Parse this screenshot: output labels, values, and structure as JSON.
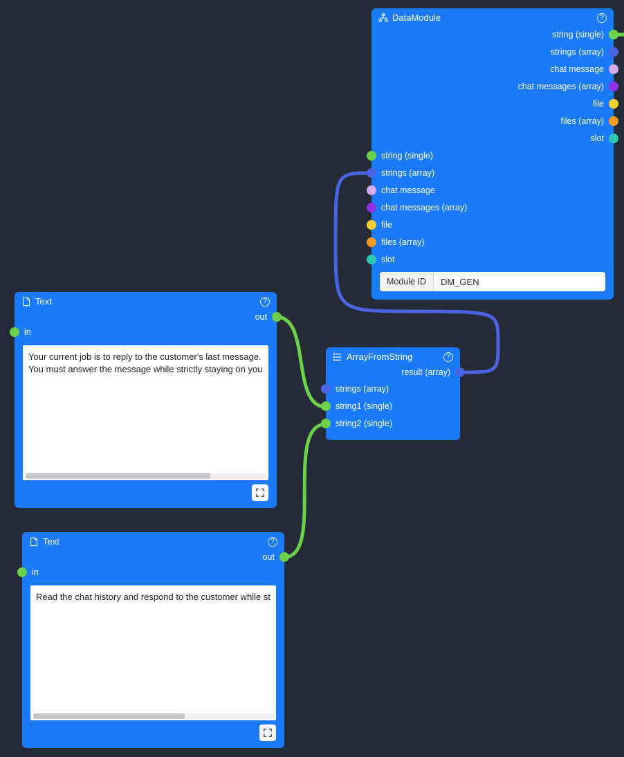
{
  "colors": {
    "node_bg": "#1a7af8",
    "canvas_bg": "#252a37",
    "wire_green": "#6bd14a",
    "wire_blue": "#4a63e0"
  },
  "nodes": {
    "datamodule": {
      "title": "DataModule",
      "module_id_label": "Module ID",
      "module_id_value": "DM_GEN",
      "outputs": [
        {
          "label": "string (single)",
          "color": "green"
        },
        {
          "label": "strings (array)",
          "color": "blue"
        },
        {
          "label": "chat message",
          "color": "lav"
        },
        {
          "label": "chat messages (array)",
          "color": "purple"
        },
        {
          "label": "file",
          "color": "yellow"
        },
        {
          "label": "files (array)",
          "color": "orange"
        },
        {
          "label": "slot",
          "color": "teal"
        }
      ],
      "inputs": [
        {
          "label": "string (single)",
          "color": "green"
        },
        {
          "label": "strings (array)",
          "color": "blue"
        },
        {
          "label": "chat message",
          "color": "lav"
        },
        {
          "label": "chat messages (array)",
          "color": "purple"
        },
        {
          "label": "file",
          "color": "yellow"
        },
        {
          "label": "files (array)",
          "color": "orange"
        },
        {
          "label": "slot",
          "color": "teal"
        }
      ]
    },
    "text1": {
      "title": "Text",
      "out_label": "out",
      "in_label": "in",
      "content_line1": "Your current job is to reply to the customer's last message.",
      "content_line2": "You must answer the message while strictly staying on your Assig",
      "scroll_thumb_pct": 77
    },
    "text2": {
      "title": "Text",
      "out_label": "out",
      "in_label": "in",
      "content_line1": "Read the chat history and respond to the customer while strictly s",
      "scroll_thumb_pct": 63
    },
    "arrayfromstring": {
      "title": "ArrayFromString",
      "out_label": "result (array)",
      "inputs": [
        {
          "label": "strings (array)",
          "color": "blue"
        },
        {
          "label": "string1 (single)",
          "color": "green"
        },
        {
          "label": "string2 (single)",
          "color": "green"
        }
      ]
    }
  }
}
